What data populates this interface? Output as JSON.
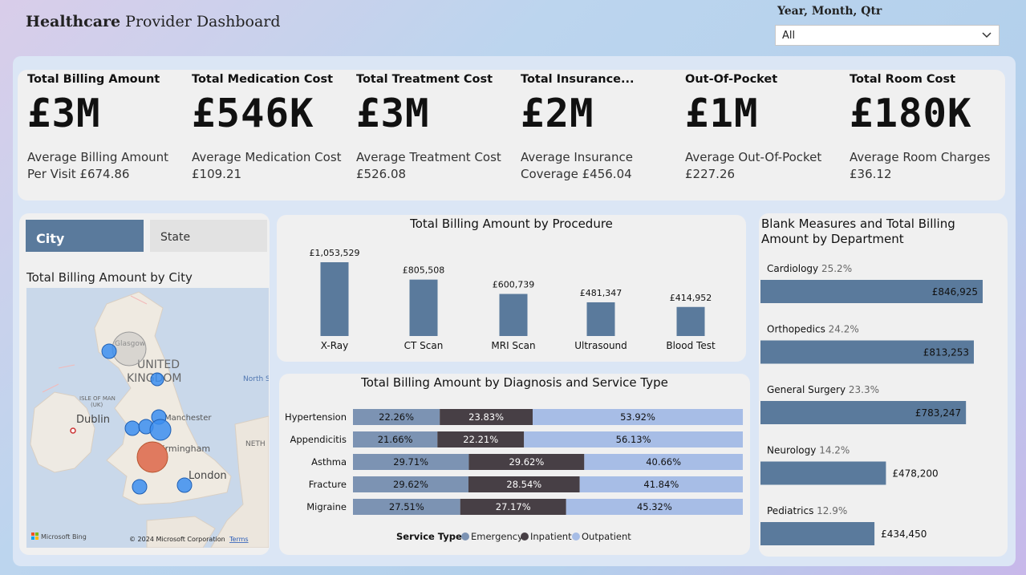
{
  "header": {
    "title_bold": "Healthcare",
    "title_rest": " Provider Dashboard",
    "slicer_label": "Year, Month, Qtr",
    "slicer_value": "All"
  },
  "kpis": [
    {
      "title": "Total Billing Amount",
      "value": "£3M",
      "sub": "Average Billing Amount Per Visit £674.86"
    },
    {
      "title": "Total Medication Cost",
      "value": "£546K",
      "sub": "Average Medication Cost £109.21"
    },
    {
      "title": "Total Treatment Cost",
      "value": "£3M",
      "sub": "Average Treatment Cost £526.08"
    },
    {
      "title": "Total Insurance...",
      "value": "£2M",
      "sub": "Average Insurance Coverage £456.04"
    },
    {
      "title": "Out-Of-Pocket",
      "value": "£1M",
      "sub": "Average Out-Of-Pocket £227.26"
    },
    {
      "title": "Total Room Cost",
      "value": "£180K",
      "sub": "Average Room Charges £36.12"
    }
  ],
  "toggle": {
    "city": "City",
    "state": "State"
  },
  "map": {
    "title": "Total Billing Amount by City",
    "labels": {
      "united": "UNITED",
      "kingdom": "KINGDOM",
      "dublin": "Dublin",
      "manchester": "Manchester",
      "birmingham": "Birmingham",
      "london": "London",
      "glasgow": "Glasgow",
      "north_sea": "North S",
      "neth": "NETH",
      "isle": "ISLE OF MAN",
      "isle2": "(UK)"
    },
    "attribution": "© 2024 Microsoft Corporation",
    "terms": "Terms",
    "brand": "Microsoft Bing",
    "colors": {
      "bubble": "#3b8ef0",
      "highlight": "#e07a5f",
      "gray": "#bdbdbd"
    }
  },
  "chart_data": [
    {
      "type": "bar",
      "title": "Total Billing Amount by Procedure",
      "categories": [
        "X-Ray",
        "CT Scan",
        "MRI Scan",
        "Ultrasound",
        "Blood Test"
      ],
      "values": [
        1053529,
        805508,
        600739,
        481347,
        414952
      ],
      "labels": [
        "£1,053,529",
        "£805,508",
        "£600,739",
        "£481,347",
        "£414,952"
      ],
      "color": "#5a7a9c"
    },
    {
      "type": "bar",
      "orientation": "horizontal-stacked-100",
      "title": "Total Billing Amount by Diagnosis and Service Type",
      "categories": [
        "Hypertension",
        "Appendicitis",
        "Asthma",
        "Fracture",
        "Migraine"
      ],
      "legend_title": "Service Type",
      "series": [
        {
          "name": "Emergency",
          "values": [
            22.26,
            21.66,
            29.71,
            29.62,
            27.51
          ],
          "color": "#7c93b3"
        },
        {
          "name": "Inpatient",
          "values": [
            23.83,
            22.21,
            29.62,
            28.54,
            27.17
          ],
          "color": "#473f45"
        },
        {
          "name": "Outpatient",
          "values": [
            53.92,
            56.13,
            40.66,
            41.84,
            45.32
          ],
          "color": "#a7bde6"
        }
      ],
      "unit": "%"
    },
    {
      "type": "bar",
      "orientation": "horizontal",
      "title_line1": "Blank Measures and Total Billing",
      "title_line2": "Amount by Department",
      "categories": [
        "Cardiology",
        "Orthopedics",
        "General Surgery",
        "Neurology",
        "Pediatrics"
      ],
      "percents": [
        "25.2%",
        "24.2%",
        "23.3%",
        "14.2%",
        "12.9%"
      ],
      "values": [
        846925,
        813253,
        783247,
        478200,
        434450
      ],
      "labels": [
        "£846,925",
        "£813,253",
        "£783,247",
        "£478,200",
        "£434,450"
      ],
      "color": "#5a7a9c"
    }
  ]
}
